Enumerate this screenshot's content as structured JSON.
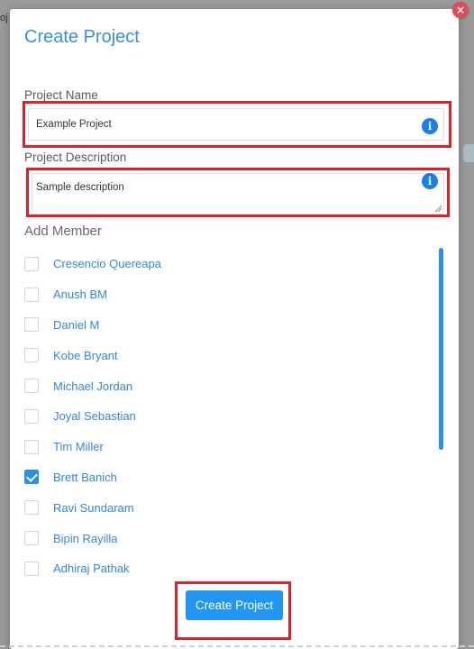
{
  "backdrop": {
    "partial_text": "oj"
  },
  "modal": {
    "close_symbol": "×",
    "title": "Create Project",
    "project_name": {
      "label": "Project Name",
      "value": "Example Project",
      "info_icon": "info-icon"
    },
    "project_description": {
      "label": "Project Description",
      "value": "Sample description",
      "info_icon": "info-icon"
    },
    "add_member": {
      "label": "Add Member",
      "members": [
        {
          "name": "Cresencio Quereapa",
          "checked": false
        },
        {
          "name": "Anush BM",
          "checked": false
        },
        {
          "name": "Daniel M",
          "checked": false
        },
        {
          "name": "Kobe Bryant",
          "checked": false
        },
        {
          "name": "Michael Jordan",
          "checked": false
        },
        {
          "name": "Joyal Sebastian",
          "checked": false
        },
        {
          "name": "Tim Miller",
          "checked": false
        },
        {
          "name": "Brett Banich",
          "checked": true
        },
        {
          "name": "Ravi Sundaram",
          "checked": false
        },
        {
          "name": "Bipin Rayilla",
          "checked": false
        },
        {
          "name": "Adhiraj Pathak",
          "checked": false
        }
      ]
    },
    "submit_label": "Create Project"
  },
  "colors": {
    "accent": "#2196f3",
    "title": "#3d8fd8",
    "highlight": "#d9232c",
    "close": "#e04b5a"
  }
}
